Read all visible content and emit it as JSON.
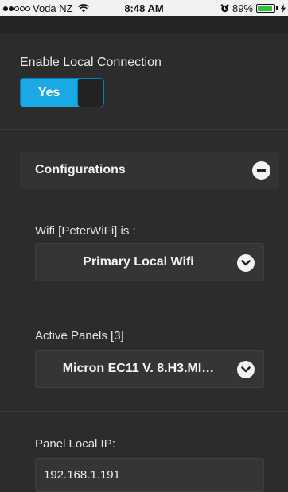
{
  "status_bar": {
    "carrier": "Voda NZ",
    "time": "8:48 AM",
    "battery": "89%",
    "battery_level": 0.89,
    "signal_bars": 2,
    "signal_total": 5
  },
  "settings": {
    "enable_local_label": "Enable Local Connection",
    "toggle_value": "Yes"
  },
  "configurations": {
    "title": "Configurations",
    "wifi": {
      "label": "Wifi [PeterWiFi] is :",
      "value": "Primary Local Wifi"
    },
    "panels": {
      "label": "Active Panels [3]",
      "value": "Micron EC11 V. 8.H3.MI…"
    },
    "ip": {
      "label": "Panel Local IP:",
      "value": "192.168.1.191"
    }
  },
  "colors": {
    "accent": "#1aa9e5",
    "background": "#2c2c2c",
    "battery": "#2fbf3b"
  }
}
